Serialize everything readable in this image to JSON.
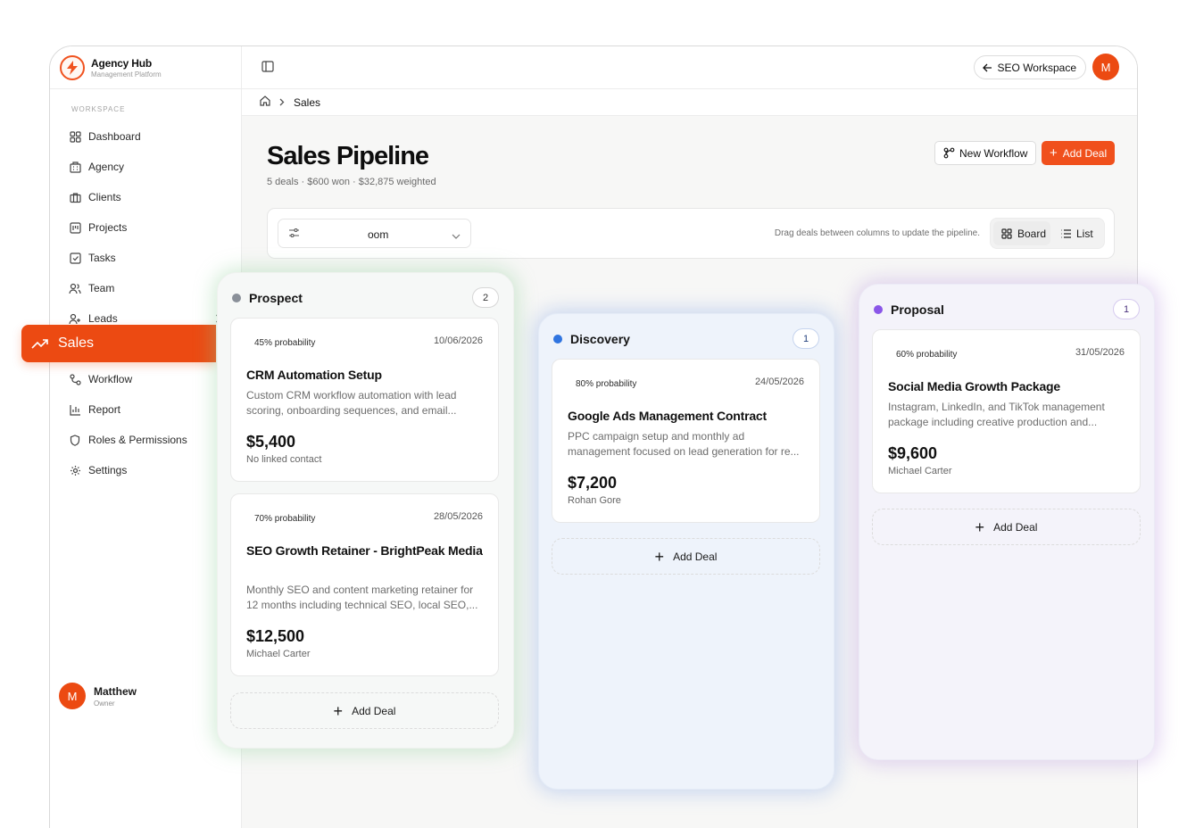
{
  "brand": {
    "title": "Agency Hub",
    "subtitle": "Management Platform"
  },
  "sidebar": {
    "section": "WORKSPACE",
    "items": [
      {
        "label": "Dashboard",
        "icon": "grid-icon"
      },
      {
        "label": "Agency",
        "icon": "building-icon"
      },
      {
        "label": "Clients",
        "icon": "briefcase-icon"
      },
      {
        "label": "Projects",
        "icon": "kanban-icon"
      },
      {
        "label": "Tasks",
        "icon": "check-square-icon"
      },
      {
        "label": "Team",
        "icon": "users-icon"
      },
      {
        "label": "Leads",
        "icon": "user-plus-icon"
      },
      {
        "label": "Sales",
        "icon": "trending-up-icon",
        "active": true
      },
      {
        "label": "Workflow",
        "icon": "workflow-icon"
      },
      {
        "label": "Report",
        "icon": "bar-chart-icon"
      },
      {
        "label": "Roles & Permissions",
        "icon": "shield-icon"
      },
      {
        "label": "Settings",
        "icon": "gear-icon"
      }
    ],
    "user": {
      "initial": "M",
      "name": "Matthew",
      "role": "Owner"
    }
  },
  "topbar": {
    "workspace_label": "SEO Workspace",
    "avatar_initial": "M"
  },
  "breadcrumb": {
    "current": "Sales"
  },
  "page": {
    "title": "Sales Pipeline",
    "subtitle": "5 deals · $600 won · $32,875 weighted",
    "new_workflow_label": "New Workflow",
    "add_deal_label": "Add Deal"
  },
  "filters": {
    "select_value": "oom",
    "hint": "Drag deals between columns to update the pipeline.",
    "view_board": "Board",
    "view_list": "List"
  },
  "columns": [
    {
      "name": "Prospect",
      "count": "2",
      "color": "#8a9099",
      "add_label": "Add Deal",
      "deals": [
        {
          "probability": "45% probability",
          "date": "10/06/2026",
          "title": "CRM Automation Setup",
          "desc": "Custom CRM workflow automation with lead scoring, onboarding sequences, and email...",
          "amount": "$5,400",
          "owner": "No linked contact"
        },
        {
          "probability": "70% probability",
          "date": "28/05/2026",
          "title": "SEO Growth Retainer - BrightPeak Media",
          "desc": "Monthly SEO and content marketing retainer for 12 months including technical SEO, local SEO,...",
          "amount": "$12,500",
          "owner": "Michael Carter"
        }
      ]
    },
    {
      "name": "Discovery",
      "count": "1",
      "color": "#2f74e0",
      "add_label": "Add Deal",
      "deals": [
        {
          "probability": "80% probability",
          "date": "24/05/2026",
          "title": "Google Ads Management Contract",
          "desc": "PPC campaign setup and monthly ad management focused on lead generation for re...",
          "amount": "$7,200",
          "owner": "Rohan Gore"
        }
      ]
    },
    {
      "name": "Proposal",
      "count": "1",
      "color": "#8a56e8",
      "add_label": "Add Deal",
      "deals": [
        {
          "probability": "60% probability",
          "date": "31/05/2026",
          "title": "Social Media Growth Package",
          "desc": "Instagram, LinkedIn, and TikTok management package including creative production and...",
          "amount": "$9,600",
          "owner": "Michael Carter"
        }
      ]
    }
  ],
  "colors": {
    "accent": "#ec4a12",
    "accent_button": "#f0501c"
  }
}
